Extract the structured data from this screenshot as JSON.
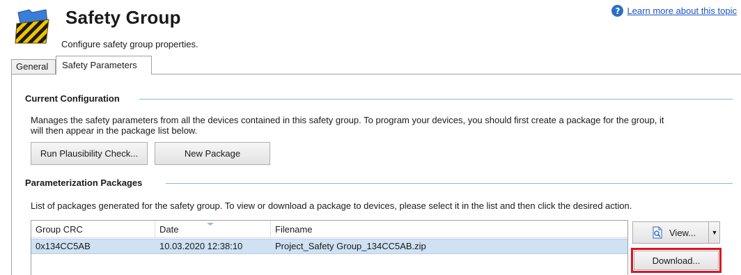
{
  "header": {
    "title": "Safety Group",
    "subtitle": "Configure safety group properties.",
    "help_link": "Learn more about this topic",
    "help_icon": "question-icon",
    "logo_icon": "safety-group-folder-icon"
  },
  "tabs": [
    {
      "label": "General",
      "active": false
    },
    {
      "label": "Safety Parameters",
      "active": true
    }
  ],
  "current_config": {
    "heading": "Current Configuration",
    "description_line1": "Manages the safety parameters from all the devices contained in this safety group.  To program your devices, you should first create a package for the group, it",
    "description_line2": "will then appear in the package list below.",
    "plausibility_button": "Run Plausibility Check...",
    "new_package_button": "New Package"
  },
  "packages": {
    "heading": "Parameterization Packages",
    "description": "List of packages generated for the safety group.  To view or download a package to devices, please select it in the list and then click the desired action.",
    "columns": [
      "Group CRC",
      "Date",
      "Filename"
    ],
    "rows": [
      {
        "crc": "0x134CC5AB",
        "date": "10.03.2020 12:38:10",
        "filename": "Project_Safety Group_134CC5AB.zip",
        "selected": true
      }
    ],
    "view_button": "View...",
    "view_icon": "document-view-icon",
    "dropdown_icon": "chevron-down-icon",
    "download_button": "Download..."
  },
  "colors": {
    "accent_link": "#1a56c4",
    "section_rule": "#8fb4dd",
    "selected_row": "#cfe1f3",
    "highlight_box": "#e0121e"
  }
}
